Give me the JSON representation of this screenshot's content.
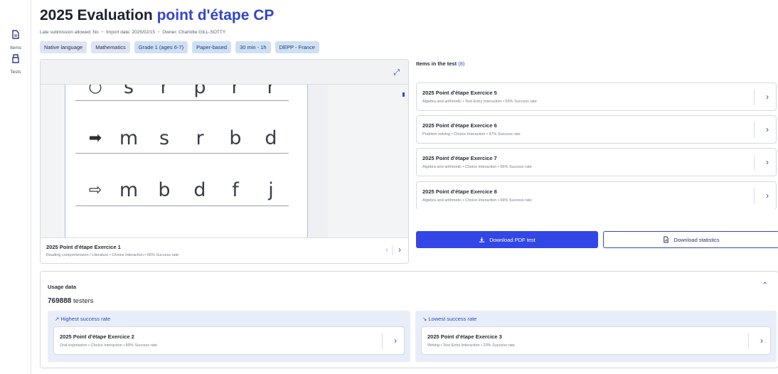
{
  "sidebar": {
    "items": [
      {
        "label": "Items",
        "icon": "document-icon"
      },
      {
        "label": "Tests",
        "icon": "tests-icon"
      }
    ]
  },
  "header": {
    "title_prefix": "2025 Evaluation ",
    "title_highlight": "point d'étape CP",
    "meta": [
      "Late submission allowed: No",
      "Import date: 2025/02/15",
      "Owner: Charlotte GILL-SOTTY"
    ],
    "tags": [
      "Native language",
      "Mathematics",
      "Grade 1 (ages 6-7)",
      "Paper-based",
      "30 min - 1h",
      "DEPP - France"
    ]
  },
  "preview": {
    "rows": [
      {
        "arrow": "○",
        "letters": [
          "s",
          "r",
          "p",
          "r",
          "r"
        ]
      },
      {
        "arrow": "➡",
        "letters": [
          "m",
          "s",
          "r",
          "b",
          "d"
        ]
      },
      {
        "arrow": "⇨",
        "letters": [
          "m",
          "b",
          "d",
          "f",
          "j"
        ]
      }
    ],
    "footer_title": "2025 Point d'étape Exercice 1",
    "footer_sub": "Reading comprehension / Literature  •  Choice Interaction  •  56% Success rate",
    "prev_icon": "chevron-left-icon",
    "next_icon": "chevron-right-icon"
  },
  "items_section": {
    "heading": "Items in the test",
    "count": "(8)",
    "items": [
      {
        "title": "2025 Point d'étape Exercice 5",
        "sub": "Algebra and arithmetic  •  Text Entry Interaction  •  65% Success rate"
      },
      {
        "title": "2025 Point d'étape Exercice 6",
        "sub": "Problem solving  •  Choice Interaction  •  97% Success rate"
      },
      {
        "title": "2025 Point d'étape Exercice 7",
        "sub": "Algebra and arithmetic  •  Choice Interaction  •  56% Success rate"
      },
      {
        "title": "2025 Point d'étape Exercice 8",
        "sub": "Algebra and arithmetic  •  Choice Interaction  •  69% Success rate"
      }
    ]
  },
  "actions": {
    "download_pdf": "Download PDF test",
    "download_stats": "Download statistics"
  },
  "usage": {
    "title": "Usage data",
    "testers_count": "769888",
    "testers_label": "testers",
    "highest": {
      "label": "Highest success rate",
      "item_title": "2025 Point d'étape Exercice 2",
      "item_sub": "Oral expression  •  Choice Interaction  •  89% Success rate"
    },
    "lowest": {
      "label": "Lowest success rate",
      "item_title": "2025 Point d'étape Exercice 3",
      "item_sub": "Writing  •  Text Entry Interaction  •  23% Success rate"
    }
  },
  "colors": {
    "accent": "#3346c8",
    "primary_button": "#3346e6",
    "tag_bg": "#dfe4f4",
    "panel_bg": "#e8eef9"
  }
}
